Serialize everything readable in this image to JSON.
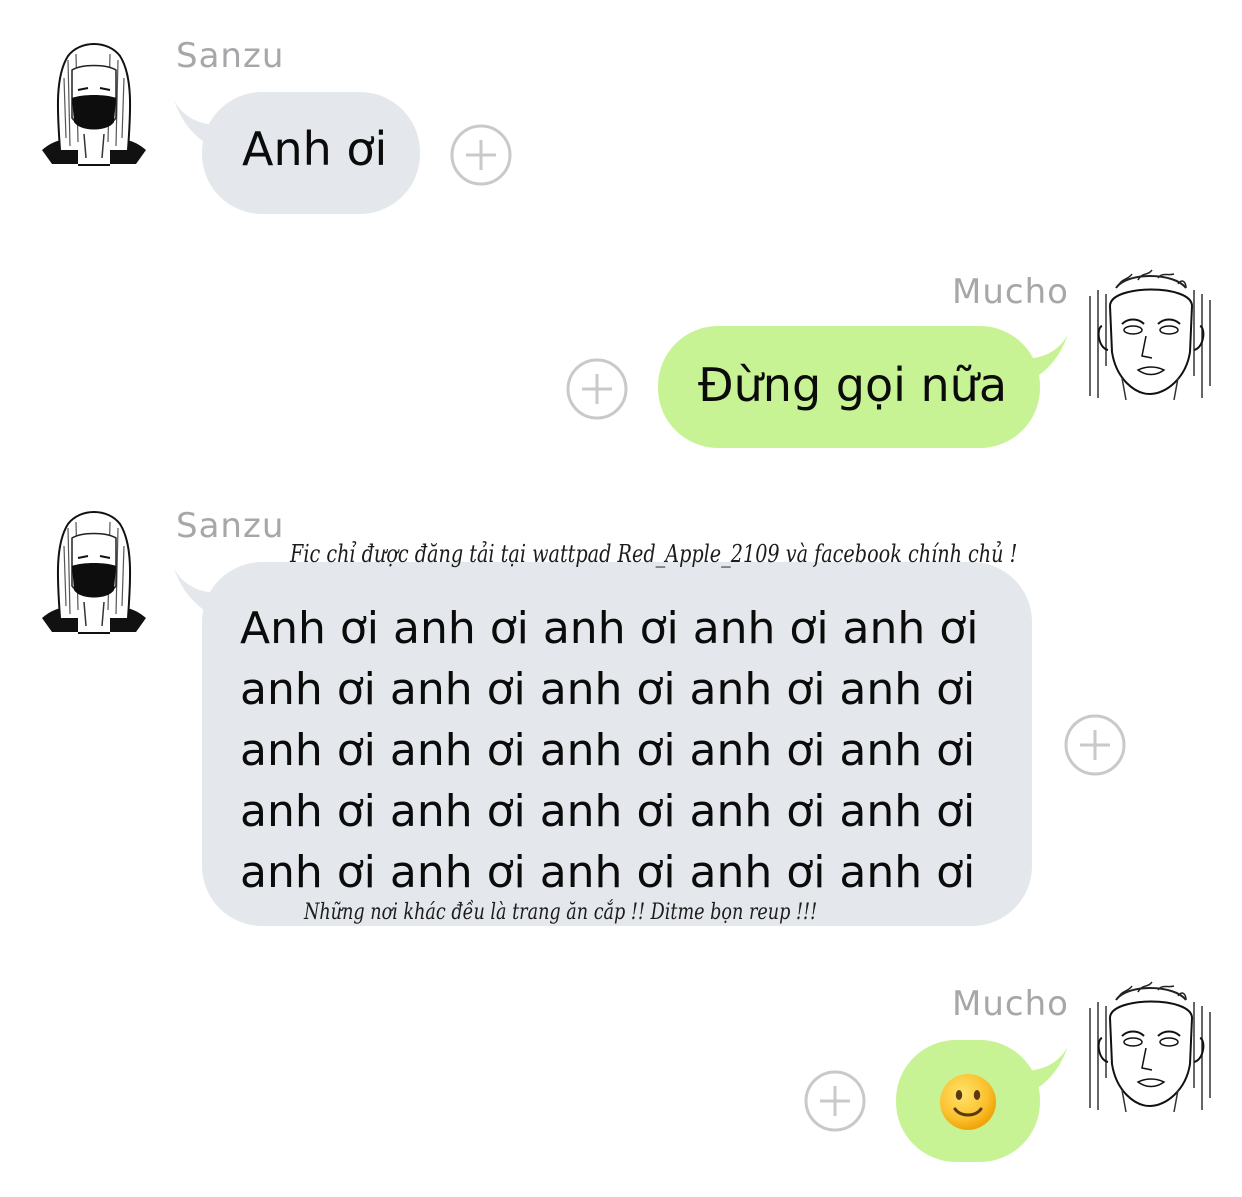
{
  "messages": [
    {
      "sender": "Sanzu",
      "text": "Anh ơi",
      "side": "left"
    },
    {
      "sender": "Mucho",
      "text": "Đừng gọi nữa",
      "side": "right"
    },
    {
      "sender": "Sanzu",
      "lines": [
        "Anh ơi anh ơi anh ơi anh ơi anh ơi",
        "anh ơi anh ơi anh ơi anh ơi anh ơi",
        "anh ơi anh ơi anh ơi anh ơi anh ơi",
        "anh ơi anh ơi anh ơi anh ơi anh ơi",
        "anh ơi anh ơi anh ơi anh ơi anh ơi"
      ],
      "side": "left"
    },
    {
      "sender": "Mucho",
      "text": "🙂",
      "side": "right"
    }
  ],
  "watermarks": {
    "top": "Fic chỉ được đăng tải tại wattpad Red_Apple_2109 và facebook chính chủ !",
    "bottom": "Những nơi khác đều là trang ăn cắp !! Ditme bọn reup !!!"
  },
  "icons": {
    "add": "add-reaction-icon",
    "avatar_sanzu": "masked-character-avatar",
    "avatar_mucho": "sketched-character-avatar"
  },
  "colors": {
    "left_bubble": "#e4e8ec",
    "right_bubble": "#c8f394",
    "sender_name": "#a7a7aa",
    "add_icon": "#c9c9cc"
  }
}
